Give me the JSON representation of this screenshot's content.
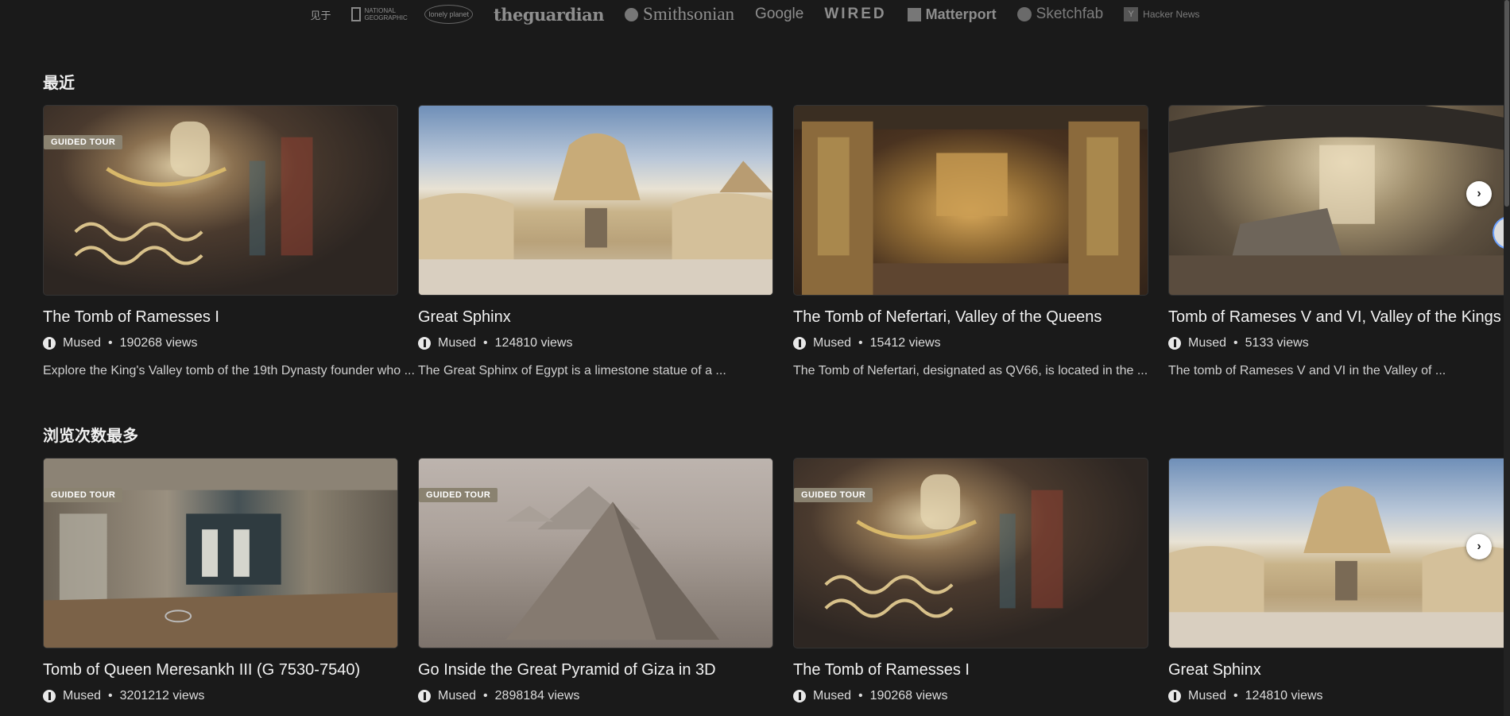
{
  "press": {
    "label": "见于",
    "natgeo": "NATIONAL GEOGRAPHIC",
    "lonely": "lonely planet",
    "guardian": "theguardian",
    "smithsonian": "Smithsonian",
    "google": "Google",
    "wired": "WIRED",
    "matterport": "Matterport",
    "sketchfab": "Sketchfab",
    "hn_letter": "Y",
    "hn": "Hacker News"
  },
  "recent": {
    "title": "最近",
    "cards": [
      {
        "badge": "GUIDED TOUR",
        "title": "The Tomb of Ramesses I",
        "author": "Mused",
        "views": "190268 views",
        "desc": "Explore the King's Valley tomb of the 19th Dynasty founder who ..."
      },
      {
        "badge": "",
        "title": "Great Sphinx",
        "author": "Mused",
        "views": "124810 views",
        "desc": "The Great Sphinx of Egypt is a limestone statue of a ..."
      },
      {
        "badge": "",
        "title": "The Tomb of Nefertari, Valley of the Queens",
        "author": "Mused",
        "views": "15412 views",
        "desc": "The Tomb of Nefertari, designated as QV66, is located in the ..."
      },
      {
        "badge": "",
        "title": "Tomb of Rameses V and VI, Valley of the Kings",
        "author": "Mused",
        "views": "5133 views",
        "desc": "The tomb of Rameses V and VI in the Valley of ..."
      }
    ]
  },
  "popular": {
    "title": "浏览次数最多",
    "cards": [
      {
        "badge": "GUIDED TOUR",
        "title": "Tomb of Queen Meresankh III (G 7530-7540)",
        "author": "Mused",
        "views": "3201212 views"
      },
      {
        "badge": "GUIDED TOUR",
        "title": "Go Inside the Great Pyramid of Giza in 3D",
        "author": "Mused",
        "views": "2898184 views"
      },
      {
        "badge": "GUIDED TOUR",
        "title": "The Tomb of Ramesses I",
        "author": "Mused",
        "views": "190268 views"
      },
      {
        "badge": "",
        "title": "Great Sphinx",
        "author": "Mused",
        "views": "124810 views"
      }
    ]
  },
  "icons": {
    "next": "chevron-right-icon",
    "creator": "mused-logo-icon"
  },
  "colors": {
    "background": "#1a1a1a",
    "badge": "#8a8270",
    "text": "#f2f2f2"
  }
}
